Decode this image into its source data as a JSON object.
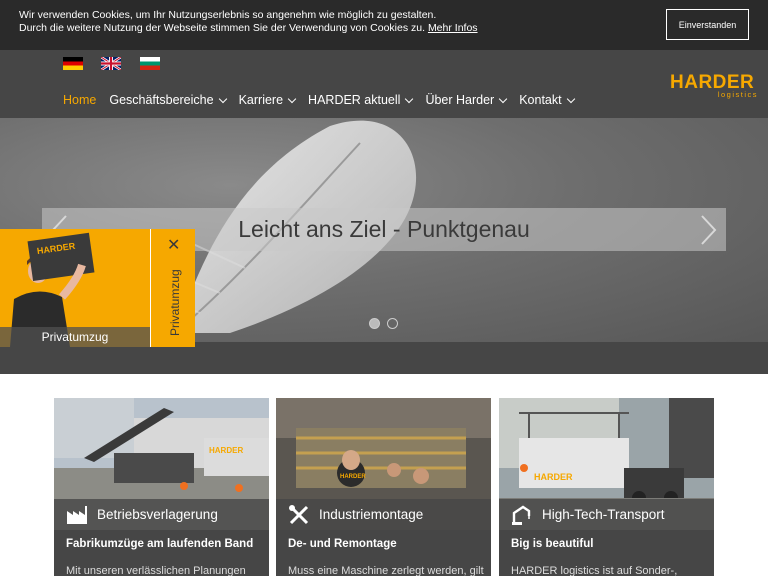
{
  "cookie": {
    "line1": "Wir verwenden Cookies, um Ihr Nutzungserlebnis so angenehm wie möglich zu gestalten.",
    "line2": "Durch die weitere Nutzung der Webseite stimmen Sie der Verwendung von Cookies zu.",
    "more_link": "Mehr Infos",
    "accept_label": "Einverstanden"
  },
  "languages": [
    "de-flag",
    "en-flag",
    "bg-flag"
  ],
  "nav": {
    "items": [
      {
        "label": "Home",
        "active": true
      },
      {
        "label": "Geschäftsbereiche"
      },
      {
        "label": "Karriere"
      },
      {
        "label": "HARDER aktuell"
      },
      {
        "label": "Über Harder"
      },
      {
        "label": "Kontakt"
      }
    ]
  },
  "logo": {
    "main": "HARDER",
    "sub": "logistics"
  },
  "hero": {
    "caption": "Leicht ans Ziel - Punktgenau",
    "slides": 2,
    "active_slide": 1
  },
  "popup": {
    "label": "Privatumzug",
    "side_label": "Privatumzug",
    "close": "✕",
    "box_text": "HARDER"
  },
  "cards": [
    {
      "title": "Betriebsverlagerung",
      "subtitle": "Fabrikumzüge am laufenden Band",
      "text": "Mit unseren verlässlichen Planungen",
      "icon": "factory-icon"
    },
    {
      "title": "Industriemontage",
      "subtitle": "De- und Remontage",
      "text": "Muss eine Maschine zerlegt werden, gilt",
      "icon": "tools-icon"
    },
    {
      "title": "High-Tech-Transport",
      "subtitle": "Big is beautiful",
      "text": "HARDER logistics ist auf Sonder-,",
      "icon": "crane-icon"
    }
  ],
  "colors": {
    "accent": "#f6a800",
    "header": "#464646",
    "cookie_bg": "#2a2a2a"
  }
}
